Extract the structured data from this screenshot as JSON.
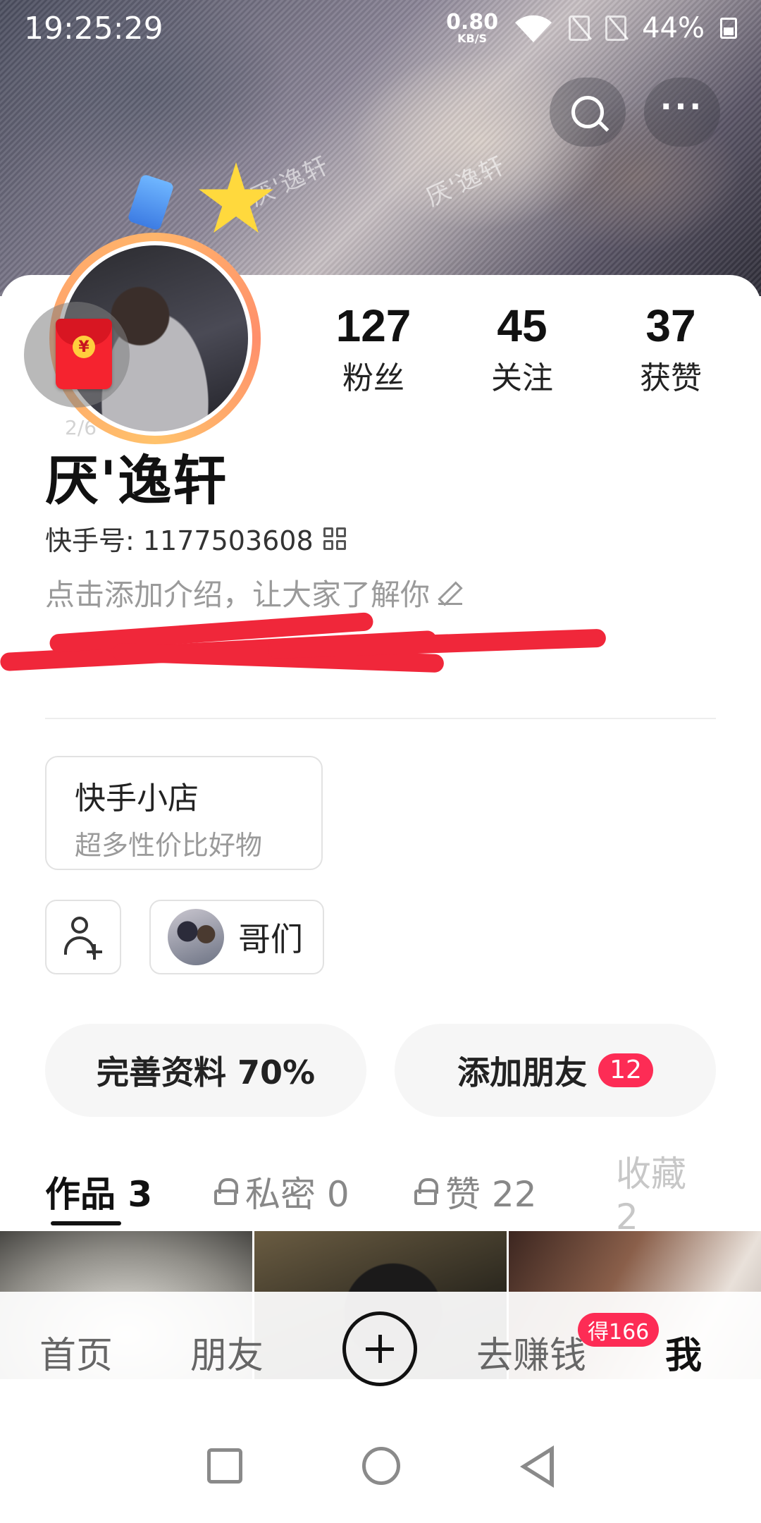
{
  "status_bar": {
    "time": "19:25:29",
    "net_speed_value": "0.80",
    "net_speed_unit": "KB/S",
    "battery_pct": "44%"
  },
  "cover": {
    "watermark": "厌'逸轩"
  },
  "avatar": {
    "pager": "2/6",
    "redpacket_glyph": "¥"
  },
  "stats": {
    "fans": {
      "value": "127",
      "label": "粉丝"
    },
    "following": {
      "value": "45",
      "label": "关注"
    },
    "likes": {
      "value": "37",
      "label": "获赞"
    }
  },
  "profile": {
    "name": "厌'逸轩",
    "kuaishou_id": "快手号: 1177503608",
    "bio_placeholder": "点击添加介绍，让大家了解你"
  },
  "shop": {
    "title": "快手小店",
    "subtitle": "超多性价比好物"
  },
  "group": {
    "name": "哥们"
  },
  "actions": {
    "complete_profile": "完善资料 70%",
    "add_friends": "添加朋友",
    "add_friends_badge": "12"
  },
  "tabs": [
    {
      "label": "作品 3"
    },
    {
      "label": "私密 0"
    },
    {
      "label": "赞 22"
    },
    {
      "label": "收藏 2"
    }
  ],
  "bottom_nav": {
    "home": "首页",
    "friends": "朋友",
    "earn": "去赚钱",
    "earn_badge": "得166",
    "me": "我"
  },
  "colors": {
    "accent_red": "#fd2c55",
    "redact_red": "#f0273a"
  }
}
